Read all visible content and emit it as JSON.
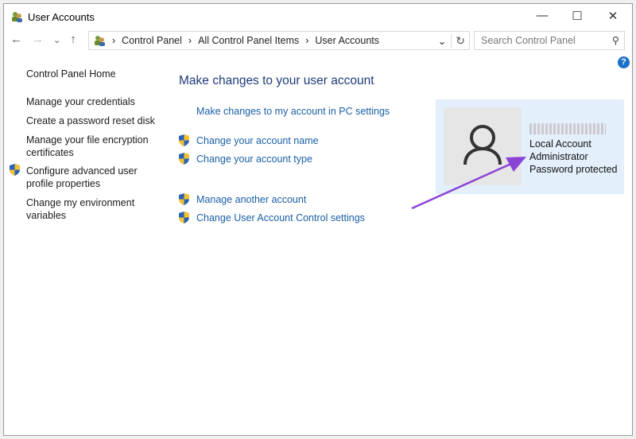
{
  "window": {
    "title": "User Accounts",
    "minimize": "—",
    "maximize": "☐",
    "close": "✕"
  },
  "nav": {
    "back": "←",
    "forward": "→",
    "recent": "⌄",
    "up": "↑"
  },
  "address": {
    "crumbs": [
      "Control Panel",
      "All Control Panel Items",
      "User Accounts"
    ],
    "sep": "›",
    "dropdown": "⌄",
    "refresh": "↻"
  },
  "search": {
    "placeholder": "Search Control Panel",
    "icon": "⚲"
  },
  "help": "?",
  "sidebar": {
    "home": "Control Panel Home",
    "items": [
      "Manage your credentials",
      "Create a password reset disk",
      "Manage your file encryption certificates",
      "Configure advanced user profile properties",
      "Change my environment variables"
    ]
  },
  "main": {
    "heading": "Make changes to your user account",
    "pc_settings": "Make changes to my account in PC settings",
    "links": [
      "Change your account name",
      "Change your account type",
      "Manage another account",
      "Change User Account Control settings"
    ]
  },
  "account": {
    "lines": [
      "Local Account",
      "Administrator",
      "Password protected"
    ]
  },
  "annotation": {
    "arrow_color": "#8b45d6"
  }
}
